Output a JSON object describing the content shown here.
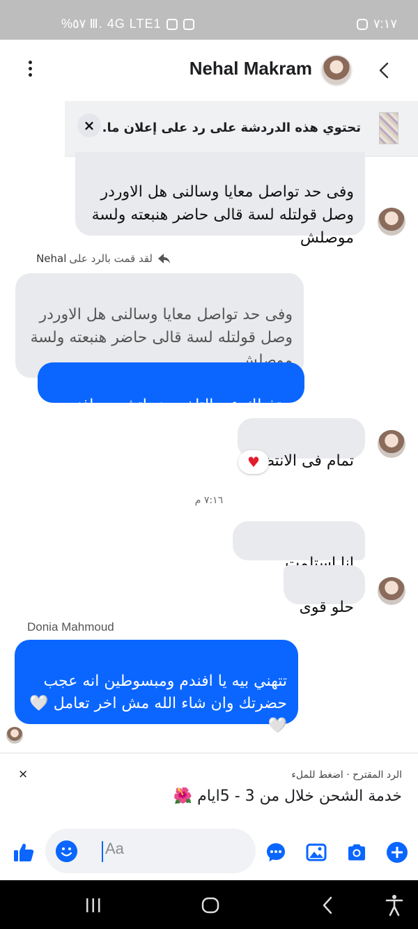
{
  "status_bar": {
    "left_text": "%٥٧ Ⅲ. 4G LTE1",
    "right_text": "٧:١٧"
  },
  "header": {
    "contact_name": "Nehal Makram",
    "menu_icon": "more-vertical-icon",
    "back_icon": "chevron-left-icon"
  },
  "ad_banner": {
    "text": "تحتوي هذه الدردشة على رد على إعلان ما.",
    "close_label": "×"
  },
  "messages": {
    "m1": "وفى حد تواصل معايا وسالنى هل الاوردر\nوصل قولتله لسة قالى حاضر هنبعته ولسة\nموصلش",
    "reply_note": "لقد قمت بالرد على",
    "reply_note_name": "Nehal",
    "quoted": "وفى حد تواصل معايا وسالنى هل الاوردر\nوصل قولتله لسة قالى حاضر هنبعته ولسة\nموصلش",
    "m2": "بعتذرلك عن التاخير هو اتشحن يافندم",
    "m3": "تمام فى الانتظار",
    "reaction": "♥",
    "timestamp": "٧:١٦ م",
    "m4": "انا استلمت الطقم",
    "m5": "حلو قوى",
    "sender_name": "Donia Mahmoud",
    "m6": "تتهني بيه يا افندم ومبسوطين انه عجب\nحضرتك وان شاء الله مش اخر تعامل 🤍\n🤍"
  },
  "suggested_reply": {
    "label": "الرد المقترح · اضغط للملء",
    "text": "خدمة الشحن خلال من 3 - 5ايام 🌺",
    "close_label": "×"
  },
  "composer": {
    "placeholder": "Aa",
    "icons": [
      "like-icon",
      "emoji-icon",
      "chat-icon",
      "gallery-icon",
      "camera-icon",
      "plus-icon"
    ]
  },
  "colors": {
    "accent": "#0a66ff",
    "incoming_bubble": "#e9eaed",
    "status_bar": "#bdbdbd"
  }
}
